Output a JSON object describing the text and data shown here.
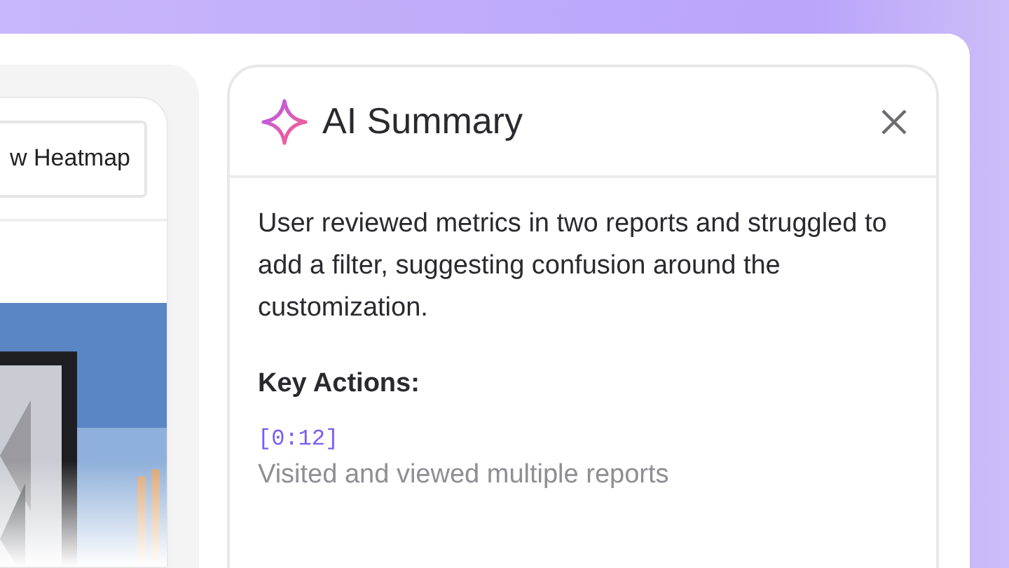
{
  "replay_panel": {
    "button": "w Heatmap"
  },
  "summary_panel": {
    "title": "AI Summary",
    "summary": "User reviewed metrics in two reports and struggled to add a filter, suggesting confusion around the customization.",
    "key_actions_heading": "Key Actions:",
    "actions": [
      {
        "time": "[0:12]",
        "description": "Visited and viewed multiple reports"
      }
    ]
  }
}
